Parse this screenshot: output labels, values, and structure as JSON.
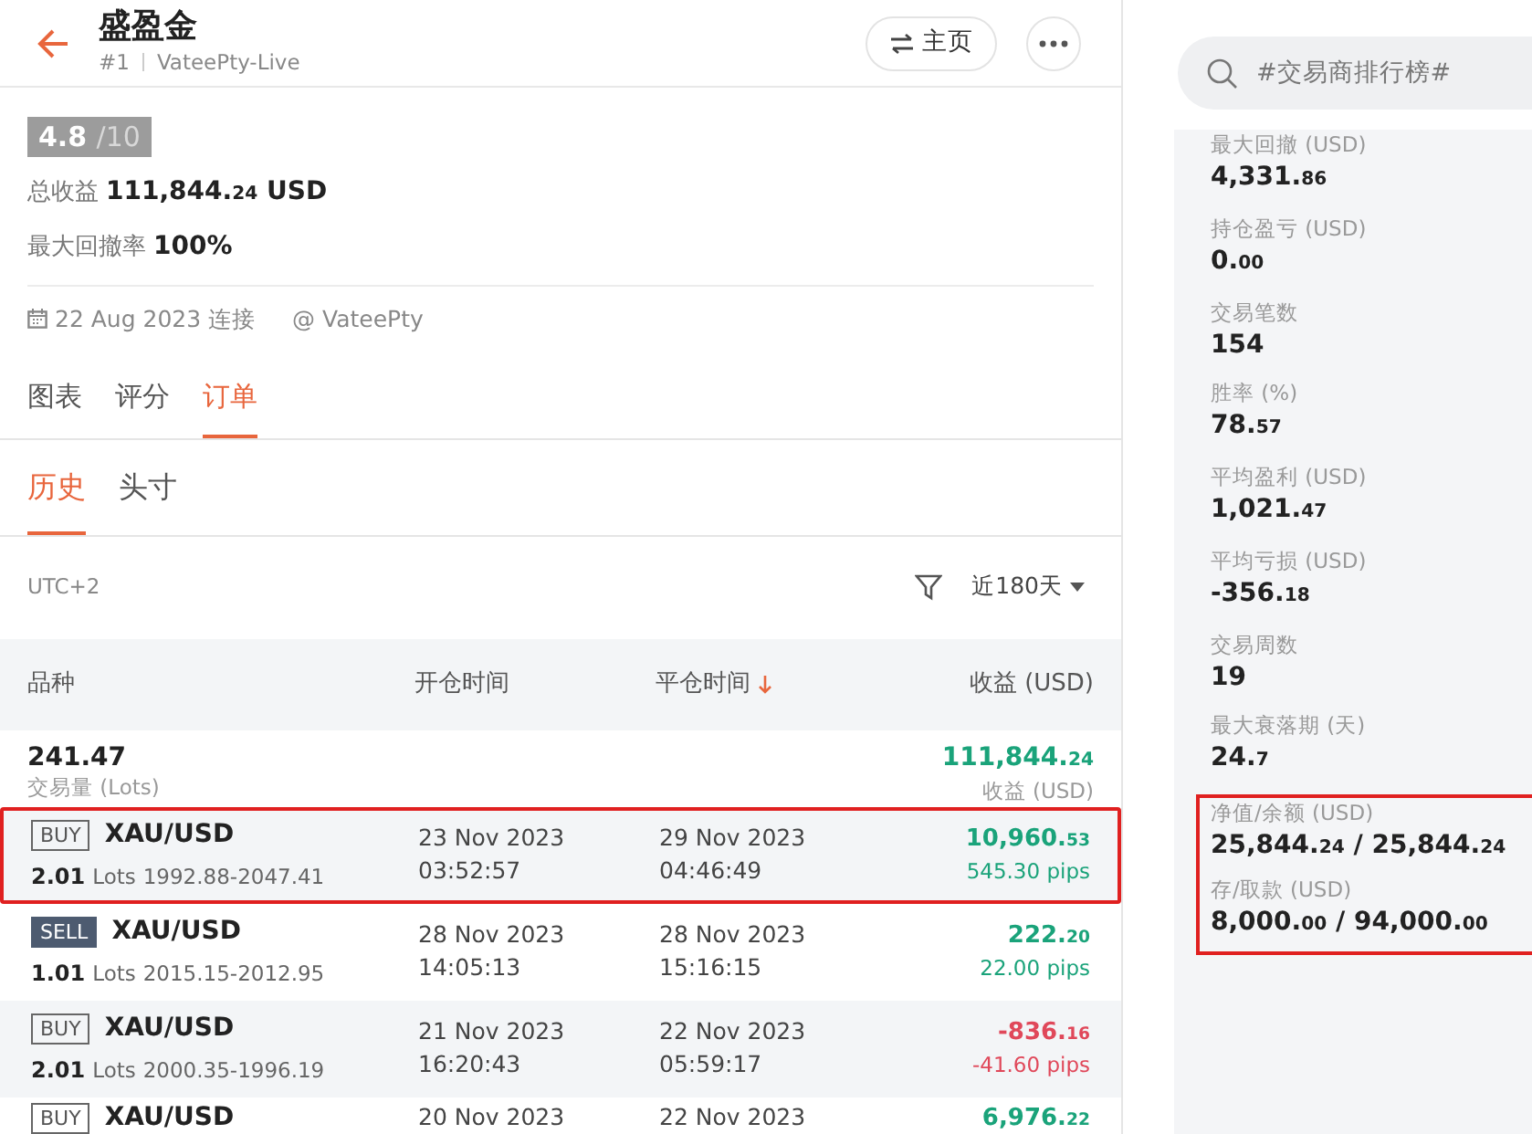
{
  "header": {
    "title": "盛盈金",
    "rank": "#1",
    "account": "VateePty-Live",
    "home_button": "主页"
  },
  "rating": {
    "score": "4.8",
    "max": "/10"
  },
  "summary": [
    {
      "label": "总收益",
      "value": "111,844.24 USD"
    },
    {
      "label": "最大回撤率",
      "value": "100%"
    }
  ],
  "connection": {
    "date": "22 Aug 2023 连接",
    "broker": "@ VateePty"
  },
  "tabs": [
    {
      "label": "图表",
      "selected": false
    },
    {
      "label": "评分",
      "selected": false
    },
    {
      "label": "订单",
      "selected": true
    }
  ],
  "subtabs": [
    {
      "label": "历史",
      "selected": true
    },
    {
      "label": "头寸",
      "selected": false
    }
  ],
  "timezone": "UTC+2",
  "period_filter": "近180天",
  "table": {
    "columns": [
      "品种",
      "开仓时间",
      "平仓时间",
      "收益 (USD)"
    ],
    "totals": {
      "volume": "241.47",
      "volume_label": "交易量 (Lots)",
      "profit": "111,844.24",
      "profit_label": "收益 (USD)"
    },
    "rows": [
      {
        "kind": "buy",
        "side": "BUY",
        "symbol": "XAU/USD",
        "lots": "2.01",
        "lots_unit": "Lots",
        "prices": "1992.88-2047.41",
        "open_date": "23 Nov 2023",
        "open_time": "03:52:57",
        "close_date": "29 Nov 2023",
        "close_time": "04:46:49",
        "profit": "10,960.53",
        "pips": "545.30 pips",
        "color": "#1aa37a",
        "highlighted": true
      },
      {
        "kind": "sell",
        "side": "SELL",
        "symbol": "XAU/USD",
        "lots": "1.01",
        "lots_unit": "Lots",
        "prices": "2015.15-2012.95",
        "open_date": "28 Nov 2023",
        "open_time": "14:05:13",
        "close_date": "28 Nov 2023",
        "close_time": "15:16:15",
        "profit": "222.20",
        "pips": "22.00 pips",
        "color": "#1aa37a",
        "highlighted": false
      },
      {
        "kind": "buy",
        "side": "BUY",
        "symbol": "XAU/USD",
        "lots": "2.01",
        "lots_unit": "Lots",
        "prices": "2000.35-1996.19",
        "open_date": "21 Nov 2023",
        "open_time": "16:20:43",
        "close_date": "22 Nov 2023",
        "close_time": "05:59:17",
        "profit": "-836.16",
        "pips": "-41.60 pips",
        "color": "#e0485a",
        "highlighted": false
      },
      {
        "kind": "buy",
        "side": "BUY",
        "symbol": "XAU/USD",
        "open_date": "20 Nov 2023",
        "close_date": "22 Nov 2023",
        "profit": "6,976.22",
        "color": "#1aa37a",
        "highlighted": false
      }
    ]
  },
  "search": {
    "placeholder": "#交易商排行榜#"
  },
  "stats": [
    {
      "label": "最大回撤 (USD)",
      "value": "4,331.86",
      "highlighted": false
    },
    {
      "label": "持仓盈亏 (USD)",
      "value": "0.00",
      "highlighted": false
    },
    {
      "label": "交易笔数",
      "value": "154",
      "highlighted": false
    },
    {
      "label": "胜率 (%)",
      "value": "78.57",
      "highlighted": false
    },
    {
      "label": "平均盈利 (USD)",
      "value": "1,021.47",
      "highlighted": false
    },
    {
      "label": "平均亏损 (USD)",
      "value": "-356.18",
      "highlighted": false
    },
    {
      "label": "交易周数",
      "value": "19",
      "highlighted": false
    },
    {
      "label": "最大衰落期 (天)",
      "value": "24.7",
      "highlighted": false
    },
    {
      "label": "净值/余额 (USD)",
      "value": "25,844.24 / 25,844.24",
      "highlighted": true
    },
    {
      "label": "存/取款 (USD)",
      "value": "8,000.00 / 94,000.00",
      "highlighted": true
    }
  ]
}
